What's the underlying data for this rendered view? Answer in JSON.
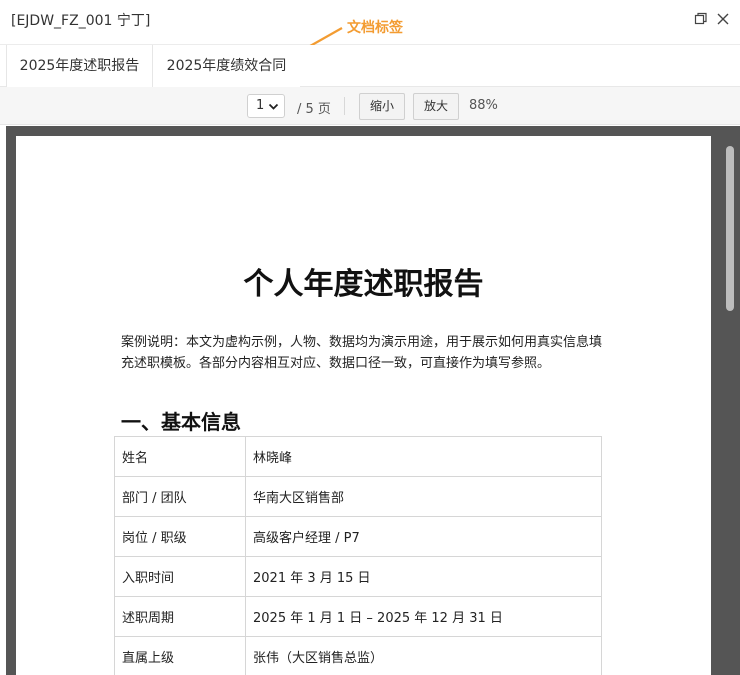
{
  "window": {
    "title": "[EJDW_FZ_001 宁丁]",
    "annotation": "文档标签"
  },
  "tabs": [
    {
      "label": "2025年度述职报告",
      "active": true
    },
    {
      "label": "2025年度绩效合同",
      "active": false
    }
  ],
  "toolbar": {
    "page_value": "1",
    "page_total": "/ 5 页",
    "zoom_out_label": "缩小",
    "zoom_in_label": "放大",
    "zoom_level": "88%"
  },
  "document": {
    "title": "个人年度述职报告",
    "intro": "案例说明：本文为虚构示例，人物、数据均为演示用途，用于展示如何用真实信息填充述职模板。各部分内容相互对应、数据口径一致，可直接作为填写参照。",
    "section_heading": "一、基本信息",
    "info_rows": [
      {
        "label": "姓名",
        "value": "林晓峰"
      },
      {
        "label": "部门 / 团队",
        "value": "华南大区销售部"
      },
      {
        "label": "岗位 / 职级",
        "value": "高级客户经理 / P7"
      },
      {
        "label": "入职时间",
        "value": "2021 年 3 月 15 日"
      },
      {
        "label": "述职周期",
        "value": "2025 年 1 月 1 日 – 2025 年 12 月 31 日"
      },
      {
        "label": "直属上级",
        "value": "张伟（大区销售总监）"
      }
    ]
  },
  "colors": {
    "annotation": "#f39c32",
    "viewer_background": "#555555"
  }
}
